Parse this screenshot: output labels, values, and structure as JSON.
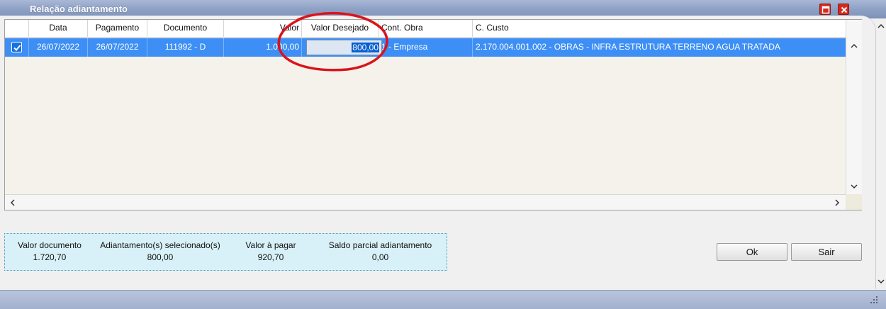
{
  "window": {
    "title": "Relação adiantamento"
  },
  "grid": {
    "columns": [
      {
        "key": "check",
        "label": ""
      },
      {
        "key": "data",
        "label": "Data"
      },
      {
        "key": "pagamento",
        "label": "Pagamento"
      },
      {
        "key": "documento",
        "label": "Documento"
      },
      {
        "key": "valor",
        "label": "Valor"
      },
      {
        "key": "valor_desejado",
        "label": "Valor Desejado"
      },
      {
        "key": "cont_obra",
        "label": "Cont. Obra"
      },
      {
        "key": "c_custo",
        "label": "C. Custo"
      }
    ],
    "rows": [
      {
        "checked": true,
        "data": "26/07/2022",
        "pagamento": "26/07/2022",
        "documento": "111992 - D",
        "valor": "1.000,00",
        "valor_desejado": "800,00",
        "cont_obra": "1 - Empresa",
        "c_custo": "2.170.004.001.002 - OBRAS - INFRA ESTRUTURA TERRENO AGUA TRATADA"
      }
    ]
  },
  "summary": {
    "valor_documento": {
      "label": "Valor documento",
      "value": "1.720,70"
    },
    "adiantamentos": {
      "label": "Adiantamento(s) selecionado(s)",
      "value": "800,00"
    },
    "valor_a_pagar": {
      "label": "Valor à pagar",
      "value": "920,70"
    },
    "saldo_parcial": {
      "label": "Saldo parcial adiantamento",
      "value": "0,00"
    }
  },
  "buttons": {
    "ok": "Ok",
    "sair": "Sair"
  },
  "colors": {
    "selected_row": "#3d8ff5",
    "annotation": "#d9141c",
    "title_close": "#d42a1e",
    "summary_bg": "#d8f0f7"
  },
  "icons": {
    "maximize": "maximize-icon",
    "close": "close-icon",
    "checkbox": "checkbox-checked-icon",
    "scroll_up": "chevron-up-icon",
    "scroll_down": "chevron-down-icon",
    "scroll_left": "chevron-left-icon",
    "scroll_right": "chevron-right-icon",
    "resize_grip": "resize-grip-icon"
  }
}
